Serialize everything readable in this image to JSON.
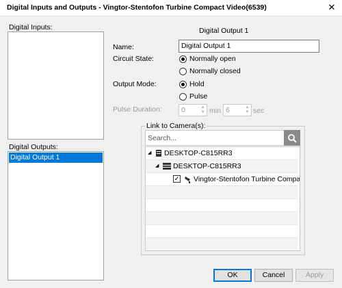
{
  "window": {
    "title": "Digital Inputs and Outputs - Vingtor-Stentofon Turbine Compact Video(6539)",
    "close_glyph": "✕"
  },
  "left": {
    "inputs_label": "Digital Inputs:",
    "outputs_label": "Digital Outputs:",
    "outputs": [
      "Digital Output 1"
    ]
  },
  "detail": {
    "heading": "Digital Output 1",
    "name_label": "Name:",
    "name_value": "Digital Output 1",
    "circuit_label": "Circuit State:",
    "circuit_options": [
      "Normally open",
      "Normally closed"
    ],
    "circuit_selected": "Normally open",
    "mode_label": "Output Mode:",
    "mode_options": [
      "Hold",
      "Pulse"
    ],
    "mode_selected": "Hold",
    "pulse_label": "Pulse Duration:",
    "pulse_min_value": "0",
    "pulse_min_unit": "min",
    "pulse_sec_value": "6",
    "pulse_sec_unit": "sec"
  },
  "camera_link": {
    "label": "Link to Camera(s):",
    "search_placeholder": "Search...",
    "tree": [
      {
        "label": "DESKTOP-C815RR3",
        "level": 0,
        "icon": "server-icon"
      },
      {
        "label": "DESKTOP-C815RR3",
        "level": 1,
        "icon": "recorder-icon"
      },
      {
        "label": "Vingtor-Stentofon Turbine Compact",
        "level": 2,
        "icon": "camera-icon",
        "checked": true
      }
    ]
  },
  "buttons": {
    "ok": "OK",
    "cancel": "Cancel",
    "apply": "Apply"
  }
}
